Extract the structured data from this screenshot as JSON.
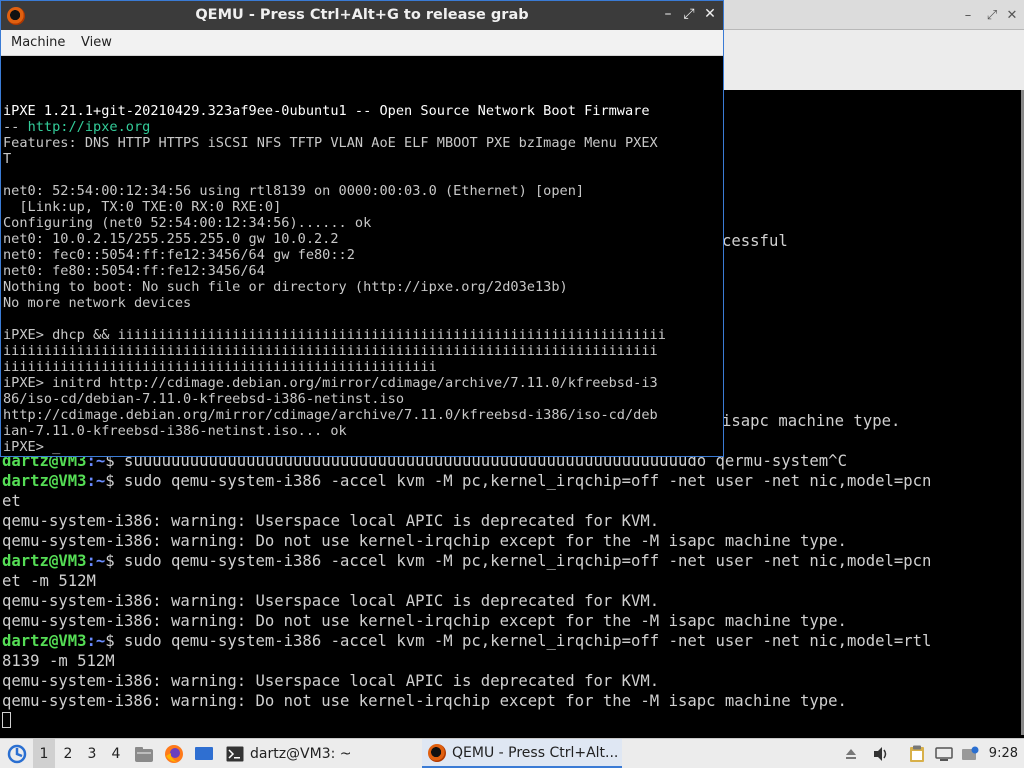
{
  "background_terminal": {
    "partial_lines": [
      {
        "text": "cessful"
      },
      {
        "text": "isapc machine type."
      }
    ],
    "lines": [
      {
        "user": "dartz@VM3",
        "path": ":~",
        "cmd": "$ suuuuuuuuuuuuuuuuuuuuuuuuuuuuuuuuuuuuuuuuuuuuuuuuuuuuuuuuuuudo qermu-system^C"
      },
      {
        "user": "dartz@VM3",
        "path": ":~",
        "cmd": "$ sudo qemu-system-i386 -accel kvm -M pc,kernel_irqchip=off -net user -net nic,model=pcn"
      },
      {
        "text": "et"
      },
      {
        "text": "qemu-system-i386: warning: Userspace local APIC is deprecated for KVM."
      },
      {
        "text": "qemu-system-i386: warning: Do not use kernel-irqchip except for the -M isapc machine type."
      },
      {
        "user": "dartz@VM3",
        "path": ":~",
        "cmd": "$ sudo qemu-system-i386 -accel kvm -M pc,kernel_irqchip=off -net user -net nic,model=pcn"
      },
      {
        "text": "et -m 512M"
      },
      {
        "text": "qemu-system-i386: warning: Userspace local APIC is deprecated for KVM."
      },
      {
        "text": "qemu-system-i386: warning: Do not use kernel-irqchip except for the -M isapc machine type."
      },
      {
        "user": "dartz@VM3",
        "path": ":~",
        "cmd": "$ sudo qemu-system-i386 -accel kvm -M pc,kernel_irqchip=off -net user -net nic,model=rtl"
      },
      {
        "text": "8139 -m 512M"
      },
      {
        "text": "qemu-system-i386: warning: Userspace local APIC is deprecated for KVM."
      },
      {
        "text": "qemu-system-i386: warning: Do not use kernel-irqchip except for the -M isapc machine type."
      }
    ]
  },
  "qemu_window": {
    "title": "QEMU - Press Ctrl+Alt+G to release grab",
    "controls": {
      "minimize": "–",
      "maximize": "⤢",
      "close": "✕"
    },
    "menu": [
      "Machine",
      "View"
    ],
    "screen_lines": [
      {
        "text": "iPXE 1.21.1+git-20210429.323af9ee-0ubuntu1 -- Open Source Network Boot Firmware",
        "style": "bright"
      },
      {
        "text": "-- ",
        "link": "http://ipxe.org"
      },
      {
        "text": "Features: DNS HTTP HTTPS iSCSI NFS TFTP VLAN AoE ELF MBOOT PXE bzImage Menu PXEX"
      },
      {
        "text": "T"
      },
      {
        "text": ""
      },
      {
        "text": "net0: 52:54:00:12:34:56 using rtl8139 on 0000:00:03.0 (Ethernet) [open]"
      },
      {
        "text": "  [Link:up, TX:0 TXE:0 RX:0 RXE:0]"
      },
      {
        "text": "Configuring (net0 52:54:00:12:34:56)...... ok"
      },
      {
        "text": "net0: 10.0.2.15/255.255.255.0 gw 10.0.2.2"
      },
      {
        "text": "net0: fec0::5054:ff:fe12:3456/64 gw fe80::2"
      },
      {
        "text": "net0: fe80::5054:ff:fe12:3456/64"
      },
      {
        "text": "Nothing to boot: No such file or directory (http://ipxe.org/2d03e13b)"
      },
      {
        "text": "No more network devices"
      },
      {
        "text": ""
      },
      {
        "text": "iPXE> dhcp && iiiiiiiiiiiiiiiiiiiiiiiiiiiiiiiiiiiiiiiiiiiiiiiiiiiiiiiiiiiiiiiiiii"
      },
      {
        "text": "iiiiiiiiiiiiiiiiiiiiiiiiiiiiiiiiiiiiiiiiiiiiiiiiiiiiiiiiiiiiiiiiiiiiiiiiiiiiiiii"
      },
      {
        "text": "iiiiiiiiiiiiiiiiiiiiiiiiiiiiiiiiiiiiiiiiiiiiiiiiiiiii"
      },
      {
        "text": "iPXE> initrd http://cdimage.debian.org/mirror/cdimage/archive/7.11.0/kfreebsd-i3"
      },
      {
        "text": "86/iso-cd/debian-7.11.0-kfreebsd-i386-netinst.iso"
      },
      {
        "text": "http://cdimage.debian.org/mirror/cdimage/archive/7.11.0/kfreebsd-i386/iso-cd/deb"
      },
      {
        "text": "ian-7.11.0-kfreebsd-i386-netinst.iso... ok"
      },
      {
        "text": "iPXE> _"
      }
    ]
  },
  "taskbar": {
    "workspaces": [
      "1",
      "2",
      "3",
      "4"
    ],
    "active_workspace": "1",
    "tasks": [
      {
        "label": "dartz@VM3: ~",
        "icon": "terminal-icon"
      },
      {
        "label": "QEMU - Press Ctrl+Alt...",
        "icon": "qemu-icon",
        "active": true
      }
    ],
    "clock": "9:28",
    "colors": {
      "accent": "#3a7bd5",
      "prompt_user": "#55dd55",
      "prompt_path": "#6a8cff"
    }
  }
}
